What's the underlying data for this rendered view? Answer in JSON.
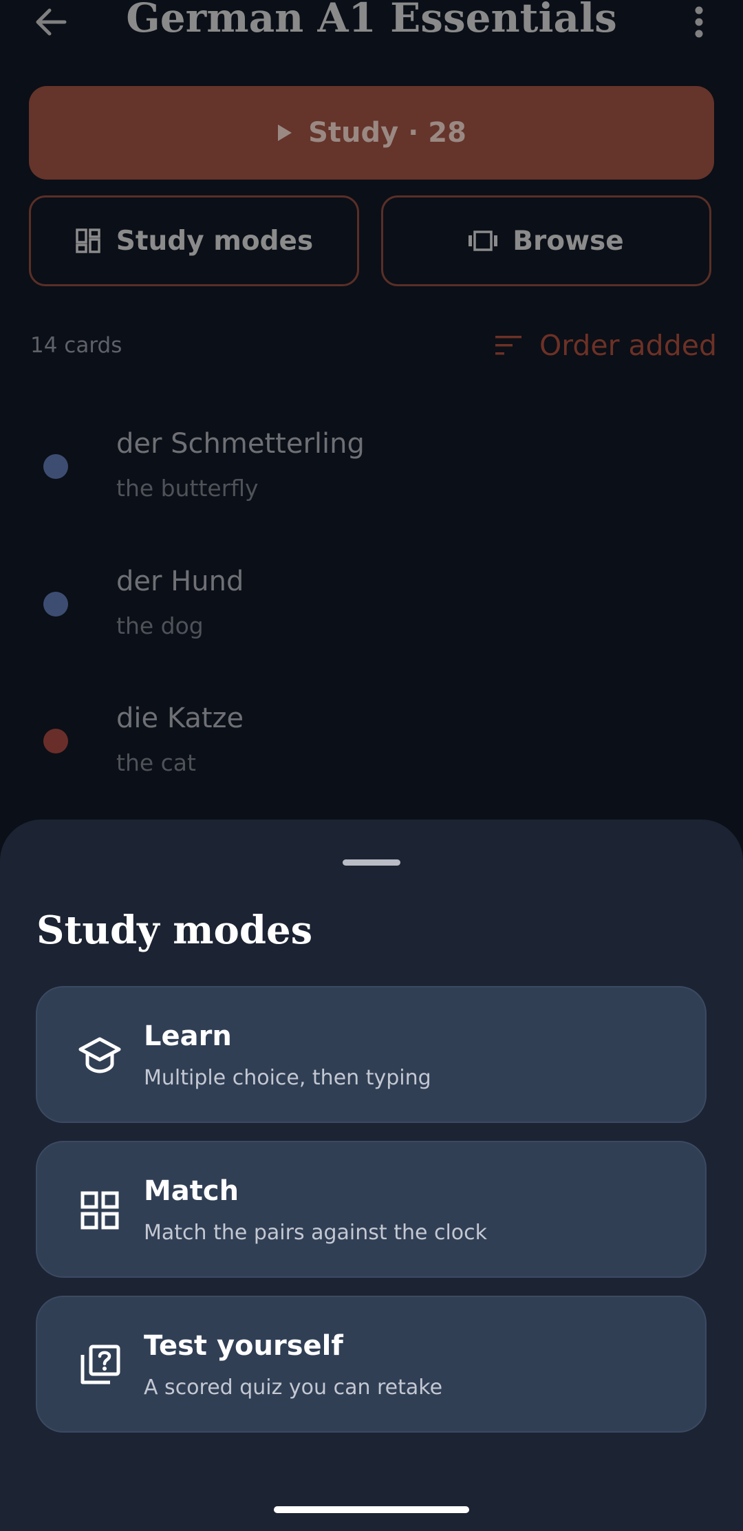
{
  "header": {
    "title": "German A1 Essentials",
    "back_icon": "arrow-left-icon",
    "more_icon": "more-vertical-icon"
  },
  "actions": {
    "study_label": "Study · 28",
    "study_modes_label": "Study modes",
    "browse_label": "Browse"
  },
  "list": {
    "count_label": "14 cards",
    "sort_label": "Order added",
    "cards": [
      {
        "term": "der Schmetterling",
        "definition": "the butterfly",
        "dot_color": "#3d4d72"
      },
      {
        "term": "der Hund",
        "definition": "the dog",
        "dot_color": "#3d4d72"
      },
      {
        "term": "die Katze",
        "definition": "the cat",
        "dot_color": "#6a2e2a"
      }
    ]
  },
  "sheet": {
    "title": "Study modes",
    "modes": [
      {
        "name": "Learn",
        "description": "Multiple choice, then typing",
        "icon": "graduation-cap-icon"
      },
      {
        "name": "Match",
        "description": "Match the pairs against the clock",
        "icon": "grid-icon"
      },
      {
        "name": "Test yourself",
        "description": "A scored quiz you can retake",
        "icon": "quiz-icon"
      }
    ]
  },
  "colors": {
    "accent": "#65342a",
    "accent_text": "#6d3126",
    "sheet_bg": "#1c2333",
    "card_bg": "#313f55",
    "page_bg": "#0b0f17"
  }
}
